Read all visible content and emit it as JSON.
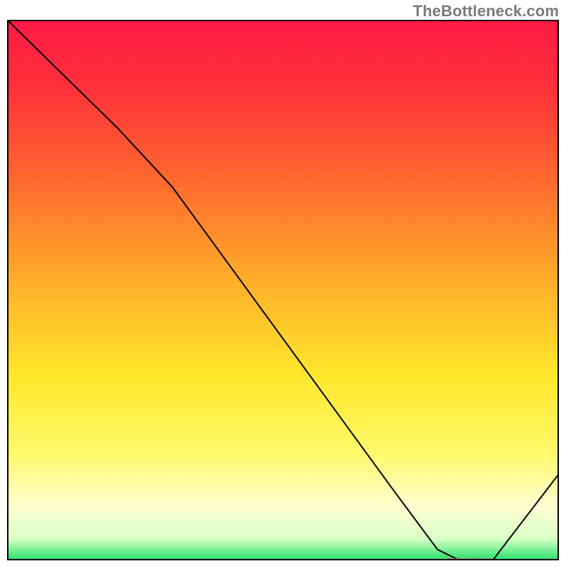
{
  "watermark": "TheBottleneck.com",
  "chart_data": {
    "type": "line",
    "title": "",
    "xlabel": "",
    "ylabel": "",
    "xlim": [
      0,
      100
    ],
    "ylim": [
      0,
      100
    ],
    "x": [
      0,
      10,
      20,
      30,
      40,
      50,
      60,
      70,
      78,
      82,
      88,
      100
    ],
    "y": [
      100,
      90,
      80,
      69,
      55,
      41,
      27,
      13,
      2,
      0,
      0,
      16
    ],
    "line_color": "#000000",
    "line_width": 2,
    "frame_color": "#000000",
    "frame_width": 4,
    "marker": {
      "x_start": 80,
      "x_end": 88,
      "y": 0.0,
      "color": "#d86a5e",
      "thickness": 6
    },
    "gradient_stops": [
      {
        "offset": 0.0,
        "color": "#ff1a44"
      },
      {
        "offset": 0.12,
        "color": "#ff2f3b"
      },
      {
        "offset": 0.3,
        "color": "#ff6a2e"
      },
      {
        "offset": 0.5,
        "color": "#ffb429"
      },
      {
        "offset": 0.66,
        "color": "#ffe72c"
      },
      {
        "offset": 0.8,
        "color": "#fff96a"
      },
      {
        "offset": 0.9,
        "color": "#feffd0"
      },
      {
        "offset": 0.96,
        "color": "#d8ffc4"
      },
      {
        "offset": 1.0,
        "color": "#23e06a"
      }
    ]
  }
}
